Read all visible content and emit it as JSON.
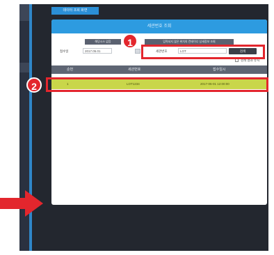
{
  "app": {
    "top_tab": "데이터 조회 화면"
  },
  "dialog": {
    "title": "세관번호 조회",
    "subbar": [
      "해당시스 없음",
      "입력되지 않은 위치의 컨테이너 상세정보 조회"
    ],
    "date_label": "접수일",
    "date_value": "2017.05.01",
    "field_label": "세관번호",
    "field_value": "LOT",
    "search_label": "검색",
    "checkbox_label": "검색 결과 유지"
  },
  "table": {
    "columns": [
      "순번",
      "세관번호",
      "접수일시"
    ],
    "rows": [
      [
        "1",
        "LOT1234",
        "2017-05-01 12:00:00"
      ]
    ]
  },
  "annotations": {
    "badge1": "1",
    "badge2": "2",
    "highlight_color": "#e3262d"
  },
  "colors": {
    "header_blue": "#2d9be0",
    "row_highlight": "#c9d64a",
    "frame_dark": "#23272f"
  }
}
